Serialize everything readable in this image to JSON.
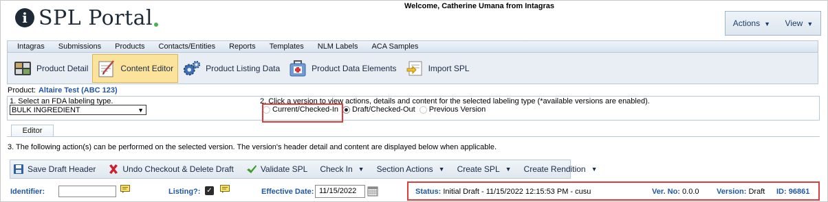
{
  "header": {
    "app_name": "SPL Portal",
    "logo_letter": "i",
    "welcome": "Welcome, Catherine Umana from Intagras",
    "actions_label": "Actions",
    "view_label": "View"
  },
  "nav": {
    "items": [
      "Intagras",
      "Submissions",
      "Products",
      "Contacts/Entities",
      "Reports",
      "Templates",
      "NLM Labels",
      "ACA Samples"
    ]
  },
  "toolbar": {
    "items": [
      {
        "label": "Product Detail",
        "icon": "product-detail-icon"
      },
      {
        "label": "Content Editor",
        "icon": "content-editor-icon",
        "active": true
      },
      {
        "label": "Product Listing Data",
        "icon": "gears-icon"
      },
      {
        "label": "Product Data Elements",
        "icon": "medical-kit-icon"
      },
      {
        "label": "Import SPL",
        "icon": "import-icon"
      }
    ]
  },
  "product": {
    "label": "Product:",
    "value": "Altaire Test (ABC 123)"
  },
  "step1": {
    "text": "1. Select an FDA labeling type.",
    "selected": "BULK INGREDIENT"
  },
  "step2": {
    "text": "2. Click a version to view actions, details and content for the selected labeling type (*available versions are enabled).",
    "options": [
      "Current/Checked-In",
      "Draft/Checked-Out",
      "Previous Version"
    ],
    "selected": "Draft/Checked-Out"
  },
  "tab": {
    "label": "Editor"
  },
  "step3": {
    "text": "3. The following action(s) can be performed on the selected version. The version's header detail and content are displayed below when applicable."
  },
  "actions": {
    "save_draft": "Save Draft Header",
    "undo_checkout": "Undo Checkout & Delete Draft",
    "validate": "Validate SPL",
    "check_in": "Check In",
    "section_actions": "Section Actions",
    "create_spl": "Create SPL",
    "create_rendition": "Create Rendition"
  },
  "header_detail": {
    "identifier_label": "Identifier:",
    "identifier_value": "",
    "listing_label": "Listing?:",
    "listing_checked": true,
    "effective_date_label": "Effective Date:",
    "effective_date": "11/15/2022",
    "status_label": "Status:",
    "status_value": "Initial Draft - 11/15/2022 12:15:53 PM - cusu",
    "ver_no_label": "Ver. No:",
    "ver_no_value": "0.0.0",
    "version_label": "Version:",
    "version_value": "Draft",
    "id_label": "ID:",
    "id_value": "96861"
  },
  "colors": {
    "accent_blue": "#1f56a8",
    "highlight_red": "#e03a3a",
    "active_tool_bg": "#fbe39c",
    "logo_dot_green": "#4caf50"
  }
}
